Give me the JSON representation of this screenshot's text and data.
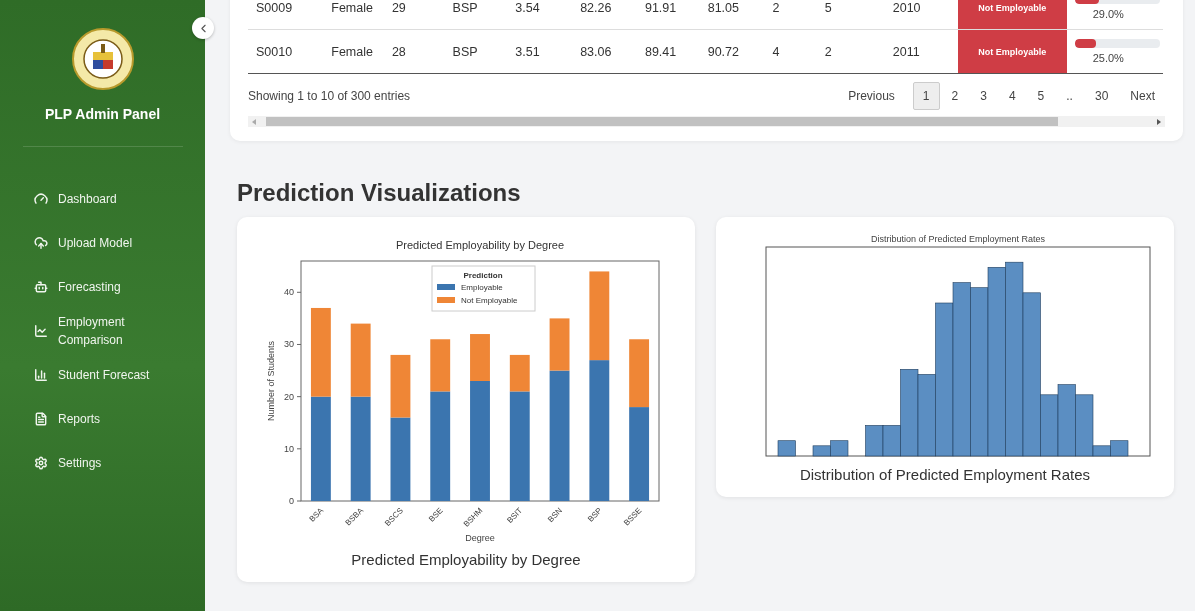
{
  "sidebar": {
    "title": "PLP Admin Panel",
    "items": [
      {
        "label": "Dashboard",
        "kind": "dashboard"
      },
      {
        "label": "Upload Model",
        "kind": "upload"
      },
      {
        "label": "Forecasting",
        "kind": "robot"
      },
      {
        "label": "Employment Comparison",
        "kind": "line"
      },
      {
        "label": "Student Forecast",
        "kind": "bars"
      },
      {
        "label": "Reports",
        "kind": "file"
      },
      {
        "label": "Settings",
        "kind": "gear"
      }
    ]
  },
  "table": {
    "rows": [
      {
        "cells": [
          "S0009",
          "Female",
          "29",
          "BSP",
          "3.54",
          "82.26",
          "91.91",
          "81.05",
          "2",
          "5",
          "2010"
        ],
        "prediction": "Not Employable",
        "level": 0.29,
        "reading": "29.0%"
      },
      {
        "cells": [
          "S0010",
          "Female",
          "28",
          "BSP",
          "3.51",
          "83.06",
          "89.41",
          "90.72",
          "4",
          "2",
          "2011"
        ],
        "prediction": "Not Employable",
        "level": 0.25,
        "reading": "25.0%"
      }
    ],
    "info": "Showing 1 to 10 of 300 entries",
    "pagination": {
      "previous": "Previous",
      "pages": [
        {
          "label": "1",
          "selected": true
        },
        {
          "label": "2",
          "selected": false
        },
        {
          "label": "3",
          "selected": false
        },
        {
          "label": "4",
          "selected": false
        },
        {
          "label": "5",
          "selected": false
        },
        {
          "label": "..",
          "selected": false
        },
        {
          "label": "30",
          "selected": false
        }
      ],
      "next": "Next"
    }
  },
  "section_title": "Prediction Visualizations",
  "charts": [
    {
      "caption": "Predicted Employability by Degree",
      "chart_data": {
        "type": "bar",
        "legend": {
          "title": "Prediction"
        },
        "title": "Predicted Employability by Degree",
        "xlabel": "Degree",
        "ylabel": "Number of Students",
        "categories": [
          "BSA",
          "BSBA",
          "BSCS",
          "BSE",
          "BSHM",
          "BSIT",
          "BSN",
          "BSP",
          "BSSE"
        ],
        "stacked": true,
        "ylim": [
          0,
          46
        ],
        "yticks": [
          0,
          10,
          20,
          30,
          40
        ],
        "series": [
          {
            "name": "Employable",
            "color": "#3b75af",
            "values": [
              20,
              20,
              16,
              21,
              23,
              21,
              25,
              27,
              18
            ]
          },
          {
            "name": "Not Employable",
            "color": "#ef8636",
            "values": [
              17,
              14,
              12,
              10,
              9,
              7,
              10,
              17,
              13
            ]
          }
        ]
      }
    },
    {
      "caption": "Distribution of Predicted Employment Rates",
      "inner_title": "Distribution of Predicted Employment Rates"
    }
  ]
}
